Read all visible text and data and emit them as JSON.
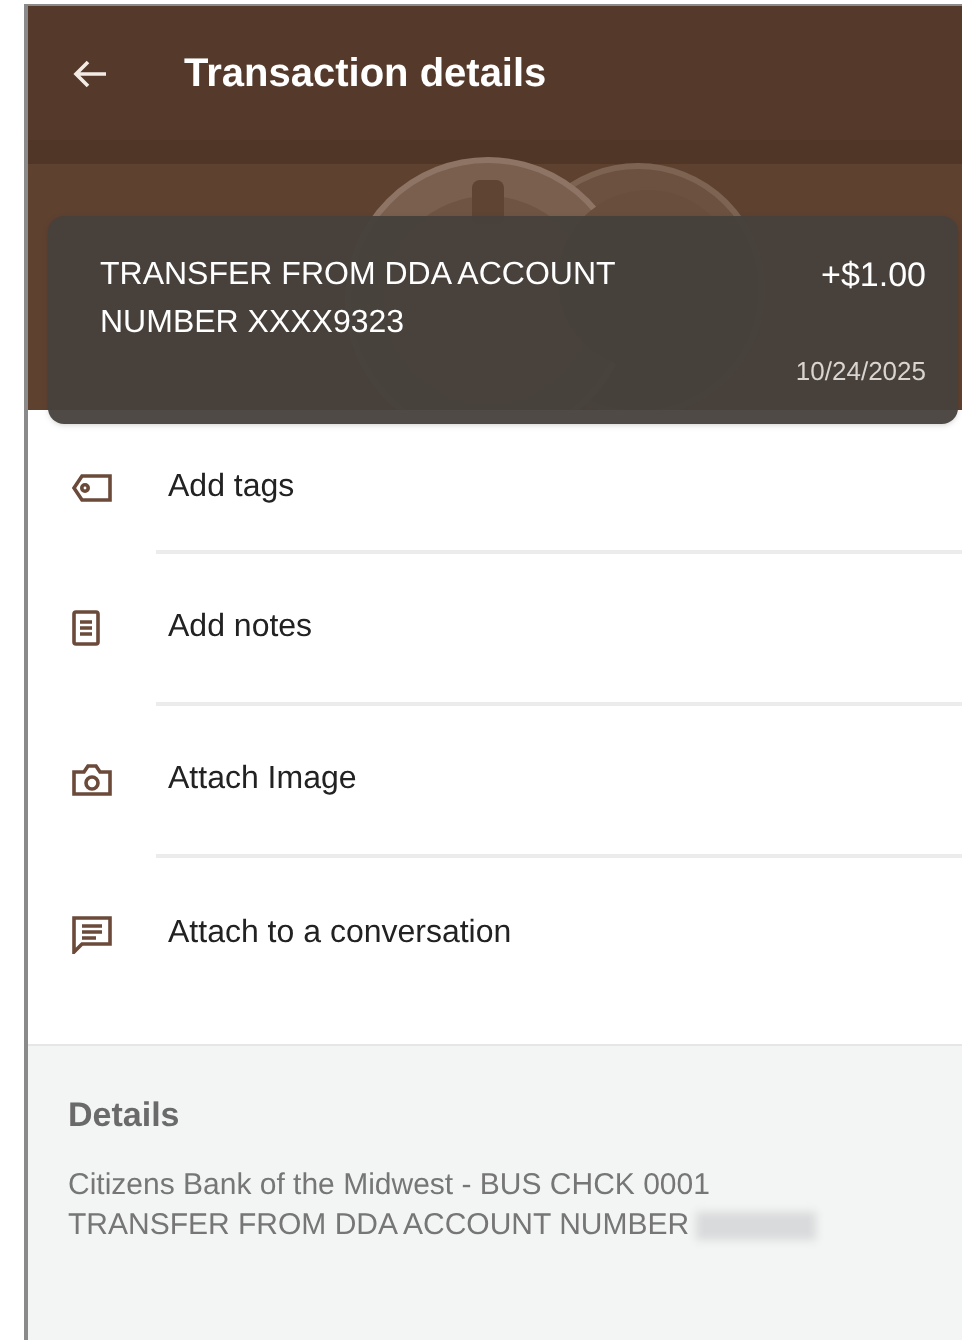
{
  "header": {
    "title": "Transaction details"
  },
  "transaction": {
    "description": "TRANSFER FROM DDA ACCOUNT NUMBER XXXX9323",
    "amount": "+$1.00",
    "date": "10/24/2025"
  },
  "actions": [
    {
      "kind": "tag",
      "label": "Add tags"
    },
    {
      "kind": "notes",
      "label": "Add notes"
    },
    {
      "kind": "camera",
      "label": "Attach Image"
    },
    {
      "kind": "chat",
      "label": "Attach to a conversation"
    }
  ],
  "details": {
    "heading": "Details",
    "lines": [
      "Citizens Bank of the Midwest - BUS CHCK 0001",
      "TRANSFER FROM DDA ACCOUNT NUMBER"
    ]
  }
}
